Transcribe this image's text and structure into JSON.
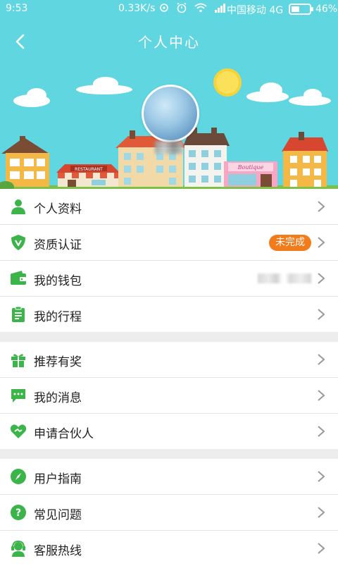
{
  "status_bar": {
    "time": "9:53",
    "network_speed": "0.33K/s",
    "carrier": "中国移动",
    "network_type": "4G",
    "battery_percent": "46%",
    "battery_level": 0.46
  },
  "header": {
    "title": "个人中心",
    "background_color": "#5fd6e0",
    "restaurant_sign": "RESTAURANT",
    "boutique_sign": "Boutique"
  },
  "groups": [
    {
      "items": [
        {
          "label": "个人资料",
          "icon": "person-icon"
        },
        {
          "label": "资质认证",
          "icon": "shield-check-icon",
          "badge": "未完成"
        },
        {
          "label": "我的钱包",
          "icon": "wallet-icon"
        },
        {
          "label": "我的行程",
          "icon": "clipboard-icon"
        }
      ]
    },
    {
      "items": [
        {
          "label": "推荐有奖",
          "icon": "gift-icon"
        },
        {
          "label": "我的消息",
          "icon": "message-icon"
        },
        {
          "label": "申请合伙人",
          "icon": "handshake-heart-icon"
        }
      ]
    },
    {
      "items": [
        {
          "label": "用户指南",
          "icon": "compass-icon"
        },
        {
          "label": "常见问题",
          "icon": "question-icon"
        },
        {
          "label": "客服热线",
          "icon": "headset-icon"
        }
      ]
    }
  ],
  "colors": {
    "accent_green": "#3bb449",
    "badge_orange": "#f27b1a"
  }
}
